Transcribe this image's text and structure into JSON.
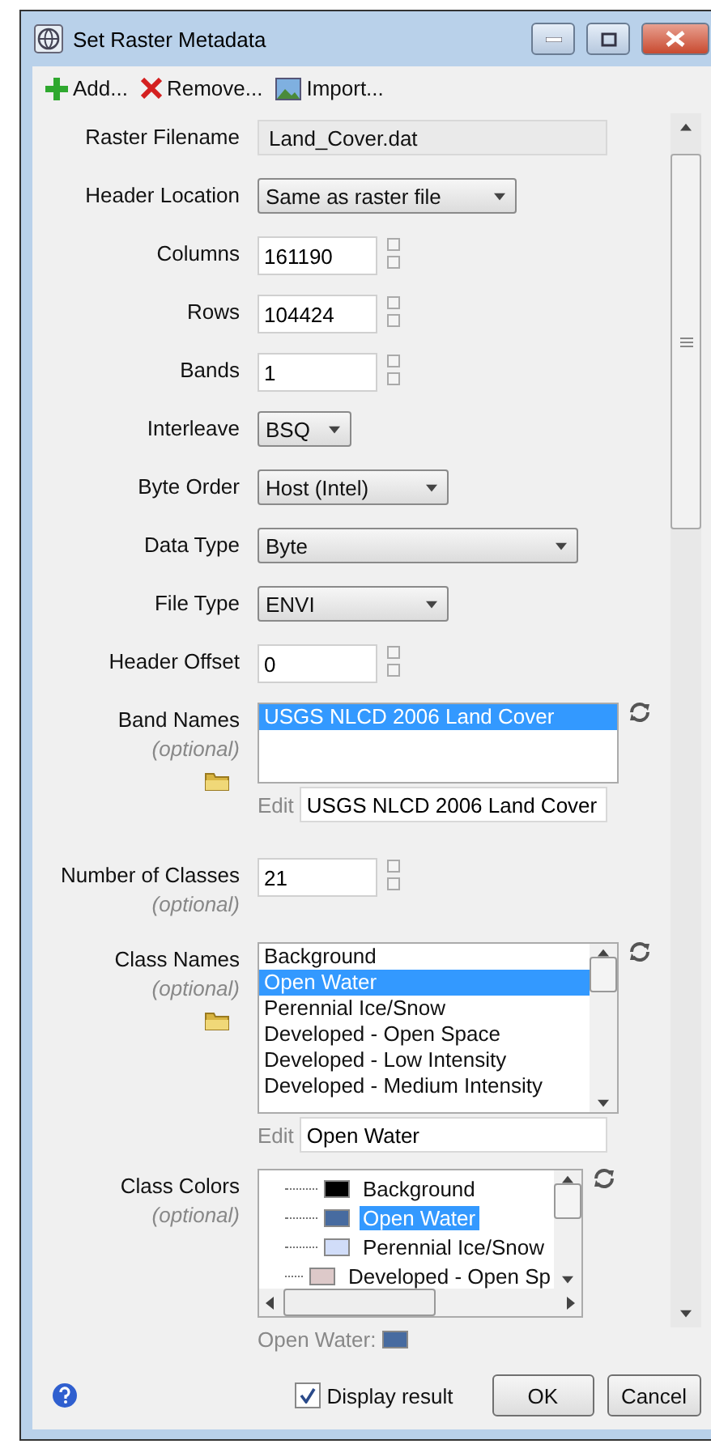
{
  "window": {
    "title": "Set Raster Metadata"
  },
  "toolbar": [
    {
      "kind": "add",
      "label": "Add..."
    },
    {
      "kind": "remove",
      "label": "Remove..."
    },
    {
      "kind": "import",
      "label": "Import..."
    }
  ],
  "fields": [
    {
      "kind": "readonly",
      "label": "Raster Filename",
      "value": "Land_Cover.dat"
    },
    {
      "kind": "dropdown",
      "label": "Header Location",
      "value": "Same as raster file"
    },
    {
      "kind": "spinner",
      "label": "Columns",
      "value": "161190"
    },
    {
      "kind": "spinner",
      "label": "Rows",
      "value": "104424"
    },
    {
      "kind": "spinner",
      "label": "Bands",
      "value": "1"
    },
    {
      "kind": "dropdown",
      "label": "Interleave",
      "value": "BSQ"
    },
    {
      "kind": "dropdown",
      "label": "Byte Order",
      "value": "Host (Intel)"
    },
    {
      "kind": "dropdown",
      "label": "Data Type",
      "value": "Byte"
    },
    {
      "kind": "dropdown",
      "label": "File Type",
      "value": "ENVI"
    },
    {
      "kind": "spinner",
      "label": "Header Offset",
      "value": "0"
    },
    {
      "kind": "namelist",
      "label": "Band Names",
      "note": "(optional)",
      "scroll": false,
      "items": [
        {
          "text": "USGS NLCD 2006 Land Cover",
          "selected": true
        }
      ],
      "edit_label": "Edit",
      "edit_value": "USGS NLCD 2006 Land Cover"
    },
    {
      "kind": "spinner",
      "label": "Number of Classes",
      "note": "(optional)",
      "value": "21"
    },
    {
      "kind": "namelist",
      "label": "Class Names",
      "note": "(optional)",
      "scroll": true,
      "items": [
        {
          "text": "Background",
          "selected": false
        },
        {
          "text": "Open Water",
          "selected": true
        },
        {
          "text": "Perennial Ice/Snow",
          "selected": false
        },
        {
          "text": "Developed - Open Space",
          "selected": false
        },
        {
          "text": "Developed - Low Intensity",
          "selected": false
        },
        {
          "text": "Developed - Medium Intensity",
          "selected": false
        }
      ],
      "edit_label": "Edit",
      "edit_value": "Open Water"
    },
    {
      "kind": "colors",
      "label": "Class Colors",
      "note": "(optional)",
      "items": [
        {
          "text": "Background",
          "color": "#000000",
          "selected": false
        },
        {
          "text": "Open Water",
          "color": "#476ba0",
          "selected": true
        },
        {
          "text": "Perennial Ice/Snow",
          "color": "#d1ddf9",
          "selected": false
        },
        {
          "text": "Developed - Open Sp",
          "color": "#ddc9c9",
          "selected": false
        }
      ],
      "current_label": "Open Water:"
    }
  ],
  "footer": {
    "checkbox": {
      "label": "Display result",
      "checked": true
    },
    "buttons": [
      "OK",
      "Cancel"
    ]
  }
}
